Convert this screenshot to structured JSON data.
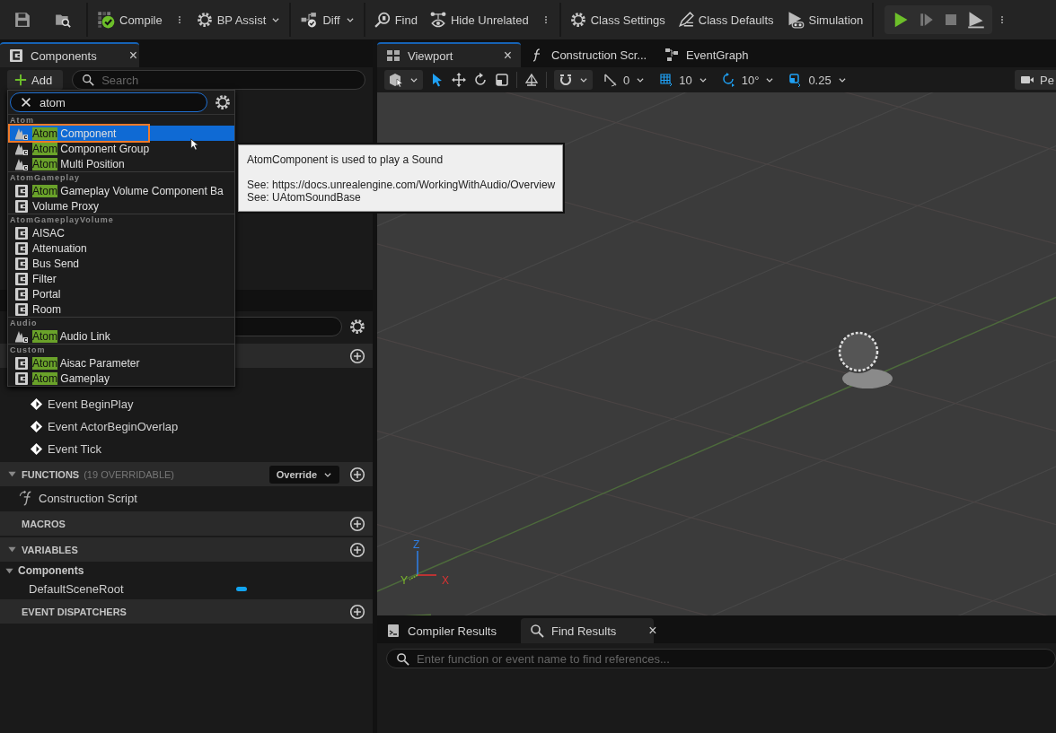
{
  "toolbar": {
    "compile": "Compile",
    "bp_assist": "BP Assist",
    "diff": "Diff",
    "find": "Find",
    "hide_unrelated": "Hide Unrelated",
    "class_settings": "Class Settings",
    "class_defaults": "Class Defaults",
    "simulation": "Simulation"
  },
  "components_panel": {
    "tab": "Components",
    "close": "×",
    "add": "Add",
    "search": {
      "placeholder": "Search"
    }
  },
  "class_picker": {
    "search": {
      "value": "atom"
    },
    "groups": [
      {
        "name": "Atom",
        "items": [
          {
            "kind": "audio",
            "highlight": "Atom",
            "text": "Component",
            "selected": true,
            "focused": true
          },
          {
            "kind": "audio",
            "highlight": "Atom",
            "text": "Component Group",
            "selected": false,
            "focused": false
          },
          {
            "kind": "audio",
            "highlight": "Atom",
            "text": "Multi Position",
            "selected": false,
            "focused": false
          }
        ]
      },
      {
        "name": "AtomGameplay",
        "items": [
          {
            "kind": "class",
            "highlight": "Atom",
            "text": "Gameplay Volume Component Ba",
            "selected": false,
            "focused": false
          },
          {
            "kind": "class",
            "text": "Volume Proxy",
            "selected": false,
            "focused": false
          }
        ]
      },
      {
        "name": "AtomGameplayVolume",
        "items": [
          {
            "kind": "class",
            "text": "AISAC",
            "selected": false,
            "focused": false
          },
          {
            "kind": "class",
            "text": "Attenuation",
            "selected": false,
            "focused": false
          },
          {
            "kind": "class",
            "text": "Bus Send",
            "selected": false,
            "focused": false
          },
          {
            "kind": "class",
            "text": "Filter",
            "selected": false,
            "focused": false
          },
          {
            "kind": "class",
            "text": "Portal",
            "selected": false,
            "focused": false
          },
          {
            "kind": "class",
            "text": "Room",
            "selected": false,
            "focused": false
          }
        ]
      },
      {
        "name": "Audio",
        "items": [
          {
            "kind": "audio",
            "highlight": "Atom",
            "text": "Audio Link",
            "selected": false,
            "focused": false
          }
        ]
      },
      {
        "name": "Custom",
        "items": [
          {
            "kind": "class",
            "highlight": "Atom",
            "text": "Aisac Parameter",
            "selected": false,
            "focused": false
          },
          {
            "kind": "class",
            "highlight": "Atom",
            "text": "Gameplay",
            "selected": false,
            "focused": false
          }
        ]
      }
    ]
  },
  "tooltip": {
    "summary": "AtomComponent is used to play a Sound",
    "see_also": [
      "See: https://docs.unrealengine.com/WorkingWithAudio/Overview",
      "See: UAtomSoundBase"
    ]
  },
  "my_blueprint": {
    "events": [
      "Event BeginPlay",
      "Event ActorBeginOverlap",
      "Event Tick"
    ],
    "sections": [
      {
        "kind": "functions",
        "title": "FUNCTIONS",
        "note": "(19 OVERRIDABLE)",
        "expanded": true,
        "override": "Override",
        "items": [
          "Construction Script"
        ]
      },
      {
        "kind": "macros",
        "title": "MACROS"
      },
      {
        "kind": "variables",
        "title": "VARIABLES",
        "expanded": true,
        "categories": [
          {
            "name": "Components",
            "expanded": true,
            "items": [
              {
                "name": "DefaultSceneRoot",
                "color": "#12a4f0"
              }
            ]
          }
        ]
      },
      {
        "kind": "dispatchers",
        "title": "EVENT DISPATCHERS"
      }
    ]
  },
  "document_tabs": [
    {
      "kind": "viewport",
      "label": "Viewport",
      "selected": true,
      "close": "×"
    },
    {
      "kind": "function",
      "label": "Construction Scr...",
      "selected": false
    },
    {
      "kind": "graph",
      "label": "EventGraph",
      "selected": false
    }
  ],
  "viewport_toolbar": {
    "surface_snap": "0",
    "grid_snap": "10",
    "rotation_snap": "10°",
    "scale_snap": "0.25",
    "view_mode": "Pe"
  },
  "viewport": {
    "axes": {
      "z": "Z",
      "y": "Y",
      "x": "X"
    }
  },
  "bottom_panel": {
    "tabs": [
      {
        "kind": "log",
        "label": "Compiler Results",
        "selected": false
      },
      {
        "kind": "search",
        "label": "Find Results",
        "selected": true,
        "close": "×"
      }
    ],
    "search": {
      "placeholder": "Enter function or event name to find references..."
    }
  }
}
